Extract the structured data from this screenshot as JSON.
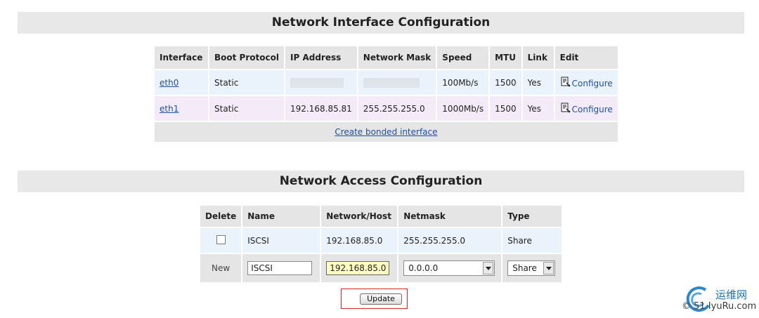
{
  "network_interface": {
    "title": "Network Interface Configuration",
    "columns": [
      "Interface",
      "Boot Protocol",
      "IP Address",
      "Network Mask",
      "Speed",
      "MTU",
      "Link",
      "Edit"
    ],
    "rows": [
      {
        "interface": "eth0",
        "boot_protocol": "Static",
        "ip_address": "",
        "network_mask": "",
        "speed": "100Mb/s",
        "mtu": "1500",
        "link": "Yes",
        "edit": "Configure"
      },
      {
        "interface": "eth1",
        "boot_protocol": "Static",
        "ip_address": "192.168.85.81",
        "network_mask": "255.255.255.0",
        "speed": "1000Mb/s",
        "mtu": "1500",
        "link": "Yes",
        "edit": "Configure"
      }
    ],
    "bonded_link": "Create bonded interface"
  },
  "network_access": {
    "title": "Network Access Configuration",
    "columns": [
      "Delete",
      "Name",
      "Network/Host",
      "Netmask",
      "Type"
    ],
    "rows": [
      {
        "name": "ISCSI",
        "network_host": "192.168.85.0",
        "netmask": "255.255.255.0",
        "type": "Share"
      }
    ],
    "new_row": {
      "label": "New",
      "name_value": "ISCSI",
      "network_host_value": "192.168.85.0",
      "netmask_selected": "0.0.0.0",
      "type_selected": "Share"
    },
    "update_button": "Update"
  },
  "watermark": {
    "line1": "运维网",
    "line2": "© 51 IyuRu.com"
  },
  "colors": {
    "header_bg": "#e8e8e8",
    "row_blue": "#eaf3fb",
    "row_pink": "#f3ecf8",
    "link": "#1f4f9e",
    "highlight_frame": "#dd2222"
  }
}
